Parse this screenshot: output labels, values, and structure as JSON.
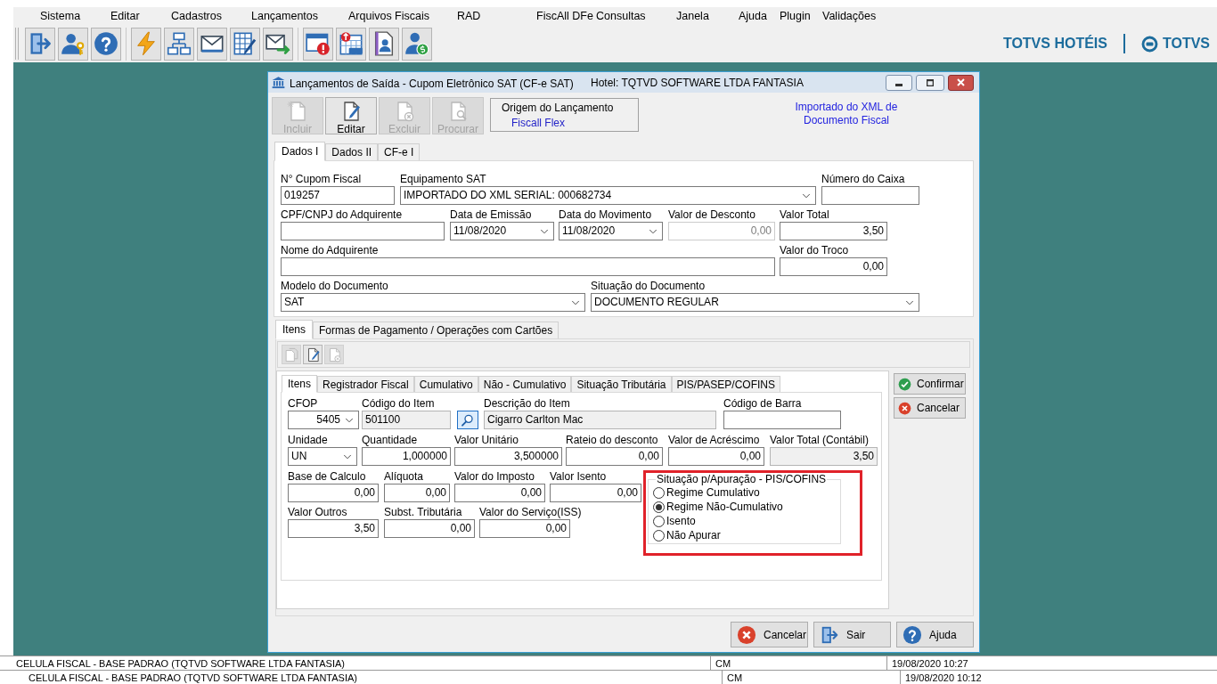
{
  "menu": [
    "Sistema",
    "Editar",
    "Cadastros",
    "Lançamentos",
    "Arquivos Fiscais",
    "RAD",
    "FiscAll DFe",
    "Consultas",
    "Janela",
    "Ajuda",
    "Plugin",
    "Validações"
  ],
  "brand": {
    "product": "TOTVS HOTÉIS",
    "company": "TOTVS"
  },
  "dialog": {
    "title": "Lançamentos de Saída - Cupom Eletrônico SAT (CF-e SAT)",
    "hotel": "Hotel: TQTVD SOFTWARE LTDA FANTASIA",
    "toolbar": [
      {
        "label": "Incluir",
        "kind": "new",
        "disabled": true
      },
      {
        "label": "Editar",
        "kind": "edit",
        "disabled": false
      },
      {
        "label": "Excluir",
        "kind": "delete",
        "disabled": true
      },
      {
        "label": "Procurar",
        "kind": "search",
        "disabled": true
      }
    ],
    "origin": {
      "label": "Origem do Lançamento",
      "value": "Fiscall Flex"
    },
    "import_note": [
      "Importado do XML de",
      "Documento Fiscal"
    ],
    "tabs": [
      {
        "label": "Dados I",
        "selected": true
      },
      {
        "label": "Dados II",
        "selected": false
      },
      {
        "label": "CF-e I",
        "selected": false
      }
    ],
    "header_rows": [
      [
        {
          "label": "N° Cupom Fiscal",
          "kind": "text",
          "value": "019257",
          "disabled": false
        },
        {
          "label": "Equipamento SAT",
          "kind": "select",
          "value": "IMPORTADO DO XML SERIAL: 000682734",
          "disabled": false
        },
        {
          "label": "Número do Caixa",
          "kind": "text",
          "disabled": false
        }
      ],
      [
        {
          "label": "CPF/CNPJ do Adquirente",
          "kind": "text",
          "disabled": false
        },
        {
          "label": "Data de Emissão",
          "kind": "select",
          "value": "11/08/2020",
          "disabled": false
        },
        {
          "label": "Data do Movimento",
          "kind": "select",
          "value": "11/08/2020",
          "disabled": false
        },
        {
          "label": "Valor de Desconto",
          "kind": "number",
          "value": "0,00",
          "disabled": true
        },
        {
          "label": "Valor Total",
          "kind": "number",
          "value": "3,50",
          "disabled": false
        }
      ],
      [
        {
          "label": "Nome do Adquirente",
          "kind": "text",
          "disabled": false
        },
        {
          "label": "Valor do Troco",
          "kind": "number",
          "value": "0,00",
          "disabled": false
        }
      ],
      [
        {
          "label": "Modelo do Documento",
          "kind": "select",
          "value": "SAT",
          "disabled": false
        },
        {
          "label": "Situação do Documento",
          "kind": "select",
          "value": "DOCUMENTO REGULAR",
          "disabled": false
        }
      ]
    ],
    "lower_tabs": [
      {
        "label": "Itens",
        "selected": true
      },
      {
        "label": "Formas de Pagamento / Operações com Cartões",
        "selected": false
      }
    ],
    "item_toolbar": [
      {
        "kind": "copy",
        "disabled": true
      },
      {
        "kind": "edit",
        "disabled": false
      },
      {
        "kind": "delete",
        "disabled": true
      }
    ],
    "item_tabs": [
      {
        "label": "Itens",
        "selected": true
      },
      {
        "label": "Registrador Fiscal",
        "selected": false
      },
      {
        "label": "Cumulativo",
        "selected": false
      },
      {
        "label": "Não - Cumulativo",
        "selected": false
      },
      {
        "label": "Situação Tributária",
        "selected": false
      },
      {
        "label": "PIS/PASEP/COFINS",
        "selected": false
      }
    ],
    "item_rows": [
      [
        {
          "label": "CFOP",
          "kind": "number_select",
          "value": "5405",
          "readonly": false
        },
        {
          "label": "Código do Item",
          "kind": "text",
          "value": "501100",
          "readonly": true
        },
        {
          "kind": "lookup"
        },
        {
          "label": "Descrição do Item",
          "kind": "text",
          "value": "Cigarro Carlton Mac",
          "readonly": true
        },
        {
          "label": "Código de Barra",
          "kind": "text",
          "readonly": false
        }
      ],
      [
        {
          "label": "Unidade",
          "kind": "select",
          "value": "UN",
          "readonly": false
        },
        {
          "label": "Quantidade",
          "kind": "number",
          "value": "1,000000",
          "readonly": false
        },
        {
          "label": "Valor Unitário",
          "kind": "number",
          "value": "3,500000",
          "readonly": false
        },
        {
          "label": "Rateio do desconto",
          "kind": "number",
          "value": "0,00",
          "readonly": false
        },
        {
          "label": "Valor de Acréscimo",
          "kind": "number",
          "value": "0,00",
          "readonly": false
        },
        {
          "label": "Valor Total (Contábil)",
          "kind": "number",
          "value": "3,50",
          "readonly": true
        }
      ],
      [
        {
          "label": "Base de Calculo",
          "kind": "number",
          "value": "0,00",
          "readonly": false
        },
        {
          "label": "Alíquota",
          "kind": "number",
          "value": "0,00",
          "readonly": false
        },
        {
          "label": "Valor do Imposto",
          "kind": "number",
          "value": "0,00",
          "readonly": false
        },
        {
          "label": "Valor Isento",
          "kind": "number",
          "value": "0,00",
          "readonly": false
        }
      ],
      [
        {
          "label": "Valor Outros",
          "kind": "number",
          "value": "3,50",
          "readonly": false
        },
        {
          "label": "Subst. Tributária",
          "kind": "number",
          "value": "0,00",
          "readonly": false
        },
        {
          "label": "Valor do Serviço(ISS)",
          "kind": "number",
          "value": "0,00",
          "readonly": false
        }
      ]
    ],
    "apuracao": {
      "title": "Situação p/Apuração - PIS/COFINS",
      "highlighted": true,
      "options": [
        {
          "label": "Regime Cumulativo",
          "selected": false
        },
        {
          "label": "Regime Não-Cumulativo",
          "selected": true
        },
        {
          "label": "Isento",
          "selected": false
        },
        {
          "label": "Não Apurar",
          "selected": false
        }
      ]
    },
    "side_buttons": [
      {
        "label": "Confirmar",
        "kind": "confirm"
      },
      {
        "label": "Cancelar",
        "kind": "cancel"
      }
    ],
    "footer_buttons": [
      {
        "label": "Cancelar",
        "kind": "cancel"
      },
      {
        "label": "Sair",
        "kind": "exit"
      },
      {
        "label": "Ajuda",
        "kind": "help"
      }
    ]
  },
  "status_bars": [
    {
      "columns": [
        "CELULA FISCAL - BASE PADRAO (TQTVD SOFTWARE LTDA FANTASIA)",
        "CM",
        "19/08/2020 10:27"
      ]
    },
    {
      "columns": [
        "CELULA FISCAL - BASE PADRAO (TQTVD SOFTWARE LTDA FANTASIA)",
        "CM",
        "19/08/2020 10:12"
      ]
    }
  ]
}
